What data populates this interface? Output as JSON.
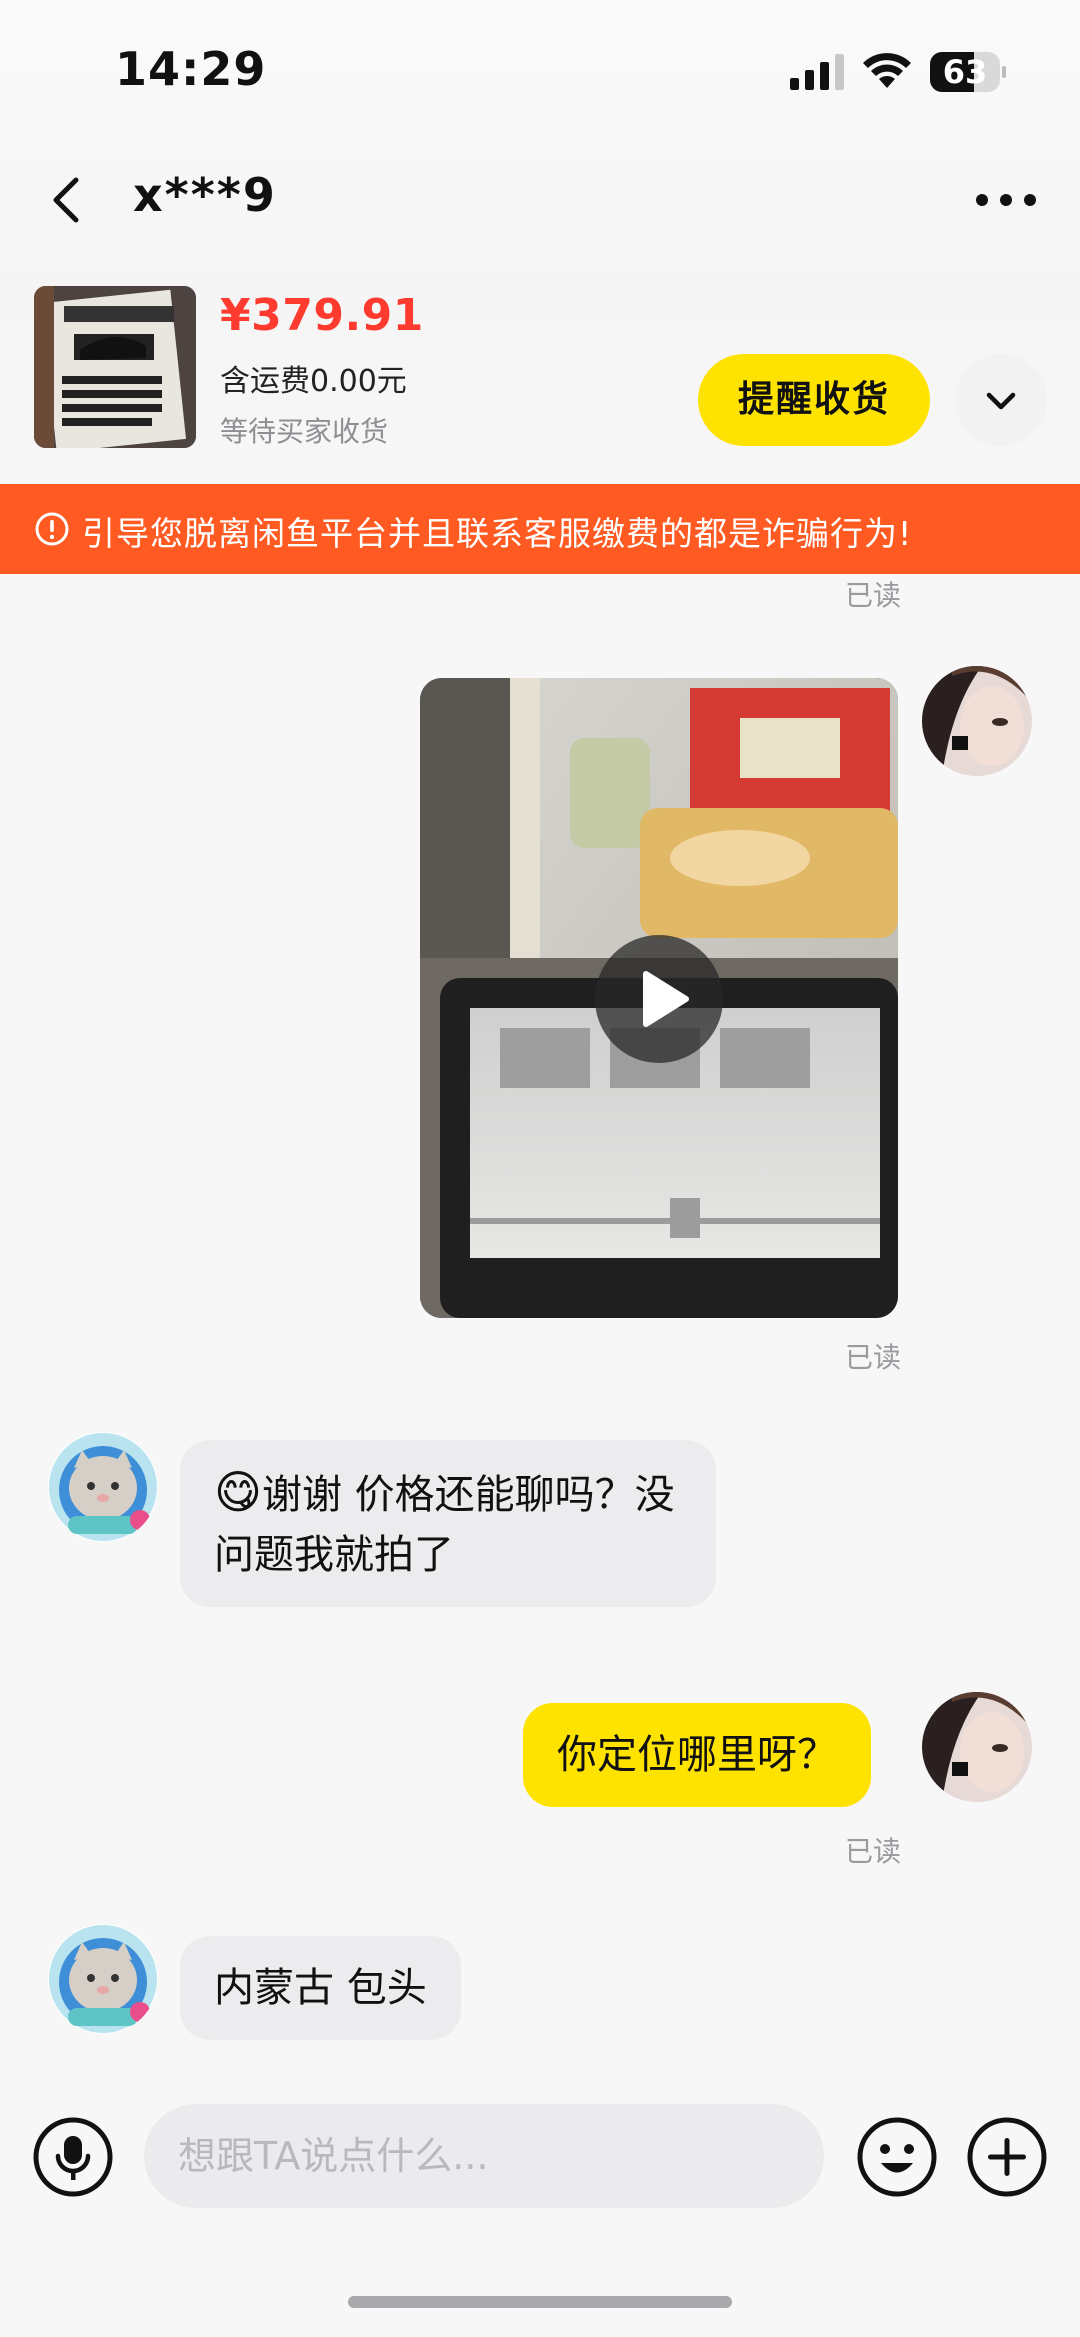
{
  "status_bar": {
    "time": "14:29",
    "battery": "63",
    "battery_level": 0.63,
    "signal_icon": "cellular-signal-icon",
    "wifi_icon": "wifi-icon"
  },
  "header": {
    "peer_name": "x***9",
    "back_icon": "chevron-left-icon",
    "more_icon": "more-dots-icon"
  },
  "product": {
    "thumbnail_icon": "product-thumbnail",
    "price": "¥379.91",
    "shipping": "含运费0.00元",
    "status": "等待买家收货",
    "remind_label": "提醒收货",
    "expand_icon": "chevron-down-icon",
    "accent": "#ff3b30"
  },
  "warning": {
    "icon": "alert-circle-icon",
    "text": "引导您脱离闲鱼平台并且联系客服缴费的都是诈骗行为!",
    "color": "#ff5a21"
  },
  "messages": [
    {
      "type": "read_receipt",
      "text": "已读"
    },
    {
      "type": "video",
      "side": "right",
      "play_icon": "play-icon"
    },
    {
      "type": "read_receipt",
      "text": "已读"
    },
    {
      "type": "text",
      "side": "left",
      "emoji": "😋",
      "text": "谢谢 价格还能聊吗？没问题我就拍了"
    },
    {
      "type": "text",
      "side": "right",
      "text": "你定位哪里呀？"
    },
    {
      "type": "read_receipt",
      "text": "已读"
    },
    {
      "type": "text",
      "side": "left",
      "text": "内蒙古 包头"
    }
  ],
  "input": {
    "placeholder": "想跟TA说点什么...",
    "mic_icon": "microphone-icon",
    "emoji_icon": "emoji-icon",
    "add_icon": "plus-circle-icon"
  },
  "colors": {
    "bubble_mine": "#ffe300",
    "bubble_theirs": "#ececee",
    "button_yellow": "#ffe300"
  }
}
